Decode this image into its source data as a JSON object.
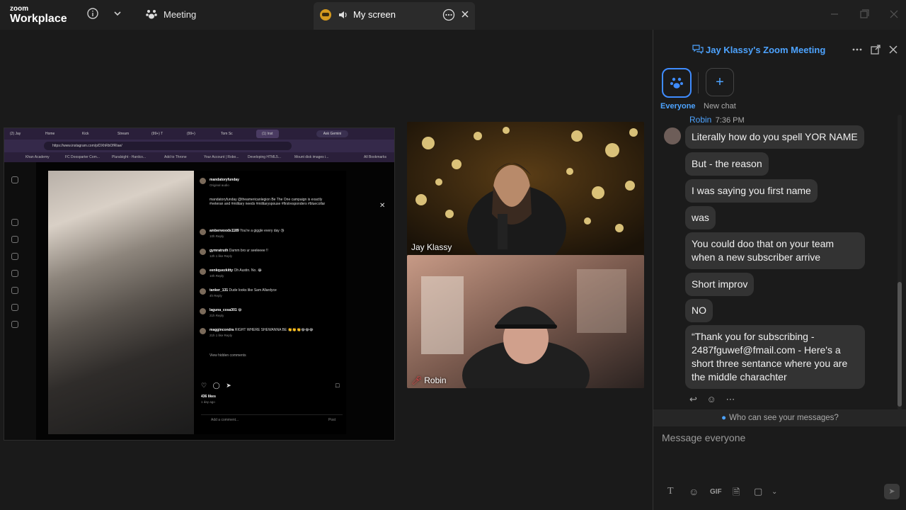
{
  "app": {
    "logo_line1": "zoom",
    "logo_line2": "Workplace"
  },
  "topbar": {
    "meeting_label": "Meeting",
    "myscreen_label": "My screen"
  },
  "share": {
    "tabs": [
      "(2) Jay",
      "Home",
      "Kick",
      "Stream",
      "(99+) T",
      "(99+)",
      "Tom Sc",
      "(1) Inst"
    ],
    "gemini_label": "Ask Gemini",
    "url": "https://www.instagram.com/p/DXhRbOfRIae/",
    "bookmarks": [
      "Khan Academy",
      "FC Doosparter Com...",
      "Pluralsight - Hardco...",
      "Add to Throne",
      "Your Account | Robo...",
      "Developing HTML5...",
      "Mount disk images i...",
      "All Bookmarks"
    ],
    "post_author": "mandatoryfunday",
    "post_subtitle": "Original audio",
    "caption": "mandatoryfunday @theamericanlegion Be The One campaign is exactly #veteran and #military needs #militaryspouse #firstresponders #bluecollar",
    "comments": [
      {
        "user": "amberwoods1189",
        "text": "You're a giggle every day 😘",
        "meta": "10h  Reply"
      },
      {
        "user": "gymratruth",
        "text": "Damm bro ur seeleeee !!",
        "meta": "12h  1 like  Reply"
      },
      {
        "user": "eenkquezkitty",
        "text": "Oh Austin. No. 😂",
        "meta": "10h  Reply"
      },
      {
        "user": "tanker_131",
        "text": "Dude looks like Sam Allardyce",
        "meta": "4h  Reply"
      },
      {
        "user": "laguna_cosa301",
        "text": "😂",
        "meta": "21h  Reply"
      },
      {
        "user": "maggincondra",
        "text": "RIGHT WHERE SHEWANNA BE 👏👏👏😂😂😂",
        "meta": "21h  1 like  Reply"
      }
    ],
    "view_hidden": "View hidden comments",
    "likes": "436 likes",
    "age": "1 day ago",
    "add_comment": "Add a comment...",
    "post_btn": "Post"
  },
  "videos": {
    "jay_name": "Jay Klassy",
    "robin_name": "Robin"
  },
  "chat": {
    "title": "Jay Klassy's Zoom Meeting",
    "tab_everyone": "Everyone",
    "tab_new": "New chat",
    "sender": "Robin",
    "time": "7:36 PM",
    "messages": [
      "Literally how do you spell YOR NAME",
      "But - the reason",
      "I was saying you first name",
      "was",
      "You could doo that on your team when a new subscriber arrive",
      "Short improv",
      "NO",
      "“Thank you for subscribing - 2487fguwef@fmail.com - Here's a short three sentance where you are the middle charachter"
    ],
    "who_can_see": "Who can see your messages?",
    "placeholder": "Message everyone",
    "gif_label": "GIF"
  },
  "colors": {
    "accent": "#4da3ff",
    "bubble": "#333333",
    "panel": "#1b1b1b"
  }
}
